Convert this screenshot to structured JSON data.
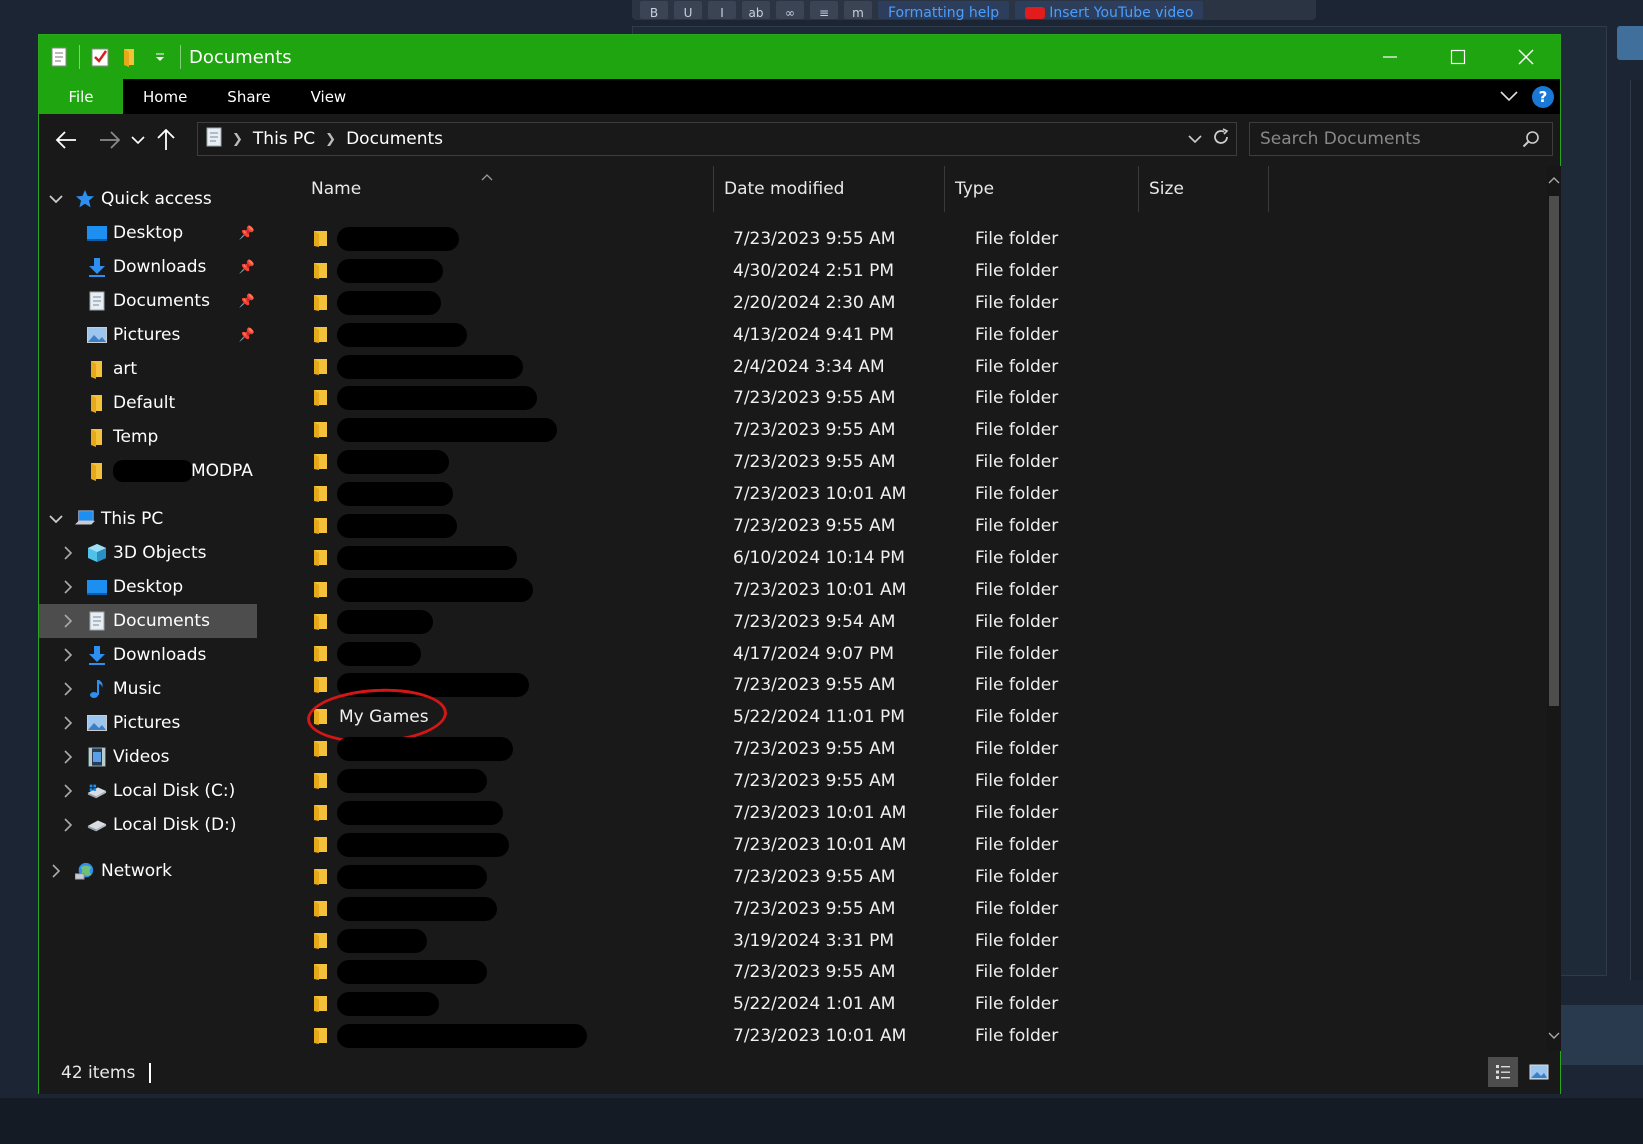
{
  "background": {
    "toolbar_buttons": [
      "B",
      "U",
      "I",
      "ab",
      "∞",
      "≡",
      "m"
    ],
    "formatting_help": "Formatting help",
    "insert_youtube": "Insert YouTube",
    "video": "video"
  },
  "window": {
    "title": "Documents",
    "accent_color": "#1ea50f"
  },
  "ribbon": {
    "tabs": [
      "File",
      "Home",
      "Share",
      "View"
    ],
    "help": "?"
  },
  "address_bar": {
    "crumbs": [
      "This PC",
      "Documents"
    ],
    "search_placeholder": "Search Documents"
  },
  "nav_pane": {
    "quick_access": "Quick access",
    "quick_items": [
      {
        "label": "Desktop",
        "icon": "desktop-icon",
        "pinned": true
      },
      {
        "label": "Downloads",
        "icon": "downloads-icon",
        "pinned": true
      },
      {
        "label": "Documents",
        "icon": "documents-icon",
        "pinned": true
      },
      {
        "label": "Pictures",
        "icon": "pictures-icon",
        "pinned": true
      },
      {
        "label": "art",
        "icon": "folder-icon",
        "pinned": false
      },
      {
        "label": "Default",
        "icon": "folder-icon",
        "pinned": false
      },
      {
        "label": "Temp",
        "icon": "folder-icon",
        "pinned": false
      },
      {
        "label": "MODPA",
        "icon": "folder-icon",
        "pinned": false
      }
    ],
    "this_pc": "This PC",
    "pc_items": [
      {
        "label": "3D Objects",
        "icon": "3d-objects-icon"
      },
      {
        "label": "Desktop",
        "icon": "desktop-icon"
      },
      {
        "label": "Documents",
        "icon": "documents-icon",
        "selected": true
      },
      {
        "label": "Downloads",
        "icon": "downloads-icon"
      },
      {
        "label": "Music",
        "icon": "music-icon"
      },
      {
        "label": "Pictures",
        "icon": "pictures-icon"
      },
      {
        "label": "Videos",
        "icon": "videos-icon"
      },
      {
        "label": "Local Disk (C:)",
        "icon": "drive-c-icon"
      },
      {
        "label": "Local Disk (D:)",
        "icon": "drive-d-icon"
      }
    ],
    "network": "Network"
  },
  "file_list": {
    "columns": [
      "Name",
      "Date modified",
      "Type",
      "Size"
    ],
    "rows": [
      {
        "name": "",
        "redacted": true,
        "date": "7/23/2023 9:55 AM",
        "type": "File folder"
      },
      {
        "name": "",
        "redacted": true,
        "date": "4/30/2024 2:51 PM",
        "type": "File folder"
      },
      {
        "name": "",
        "redacted": true,
        "date": "2/20/2024 2:30 AM",
        "type": "File folder"
      },
      {
        "name": "",
        "redacted": true,
        "date": "4/13/2024 9:41 PM",
        "type": "File folder"
      },
      {
        "name": "",
        "redacted": true,
        "date": "2/4/2024 3:34 AM",
        "type": "File folder"
      },
      {
        "name": "",
        "redacted": true,
        "date": "7/23/2023 9:55 AM",
        "type": "File folder"
      },
      {
        "name": "",
        "redacted": true,
        "date": "7/23/2023 9:55 AM",
        "type": "File folder"
      },
      {
        "name": "",
        "redacted": true,
        "date": "7/23/2023 9:55 AM",
        "type": "File folder"
      },
      {
        "name": "",
        "redacted": true,
        "date": "7/23/2023 10:01 AM",
        "type": "File folder"
      },
      {
        "name": "",
        "redacted": true,
        "date": "7/23/2023 9:55 AM",
        "type": "File folder"
      },
      {
        "name": "",
        "redacted": true,
        "date": "6/10/2024 10:14 PM",
        "type": "File folder"
      },
      {
        "name": "",
        "redacted": true,
        "date": "7/23/2023 10:01 AM",
        "type": "File folder"
      },
      {
        "name": "",
        "redacted": true,
        "date": "7/23/2023 9:54 AM",
        "type": "File folder"
      },
      {
        "name": "",
        "redacted": true,
        "date": "4/17/2024 9:07 PM",
        "type": "File folder"
      },
      {
        "name": "",
        "redacted": true,
        "date": "7/23/2023 9:55 AM",
        "type": "File folder"
      },
      {
        "name": "My Games",
        "redacted": false,
        "circled": true,
        "date": "5/22/2024 11:01 PM",
        "type": "File folder"
      },
      {
        "name": "",
        "redacted": true,
        "date": "7/23/2023 9:55 AM",
        "type": "File folder"
      },
      {
        "name": "",
        "redacted": true,
        "date": "7/23/2023 9:55 AM",
        "type": "File folder"
      },
      {
        "name": "",
        "redacted": true,
        "date": "7/23/2023 10:01 AM",
        "type": "File folder"
      },
      {
        "name": "",
        "redacted": true,
        "date": "7/23/2023 10:01 AM",
        "type": "File folder"
      },
      {
        "name": "",
        "redacted": true,
        "date": "7/23/2023 9:55 AM",
        "type": "File folder"
      },
      {
        "name": "",
        "redacted": true,
        "date": "7/23/2023 9:55 AM",
        "type": "File folder"
      },
      {
        "name": "",
        "redacted": true,
        "date": "3/19/2024 3:31 PM",
        "type": "File folder"
      },
      {
        "name": "",
        "redacted": true,
        "date": "7/23/2023 9:55 AM",
        "type": "File folder"
      },
      {
        "name": "",
        "redacted": true,
        "date": "5/22/2024 1:01 AM",
        "type": "File folder"
      },
      {
        "name": "",
        "redacted": true,
        "date": "7/23/2023 10:01 AM",
        "type": "File folder"
      }
    ]
  },
  "status_bar": {
    "item_count": "42 items"
  }
}
